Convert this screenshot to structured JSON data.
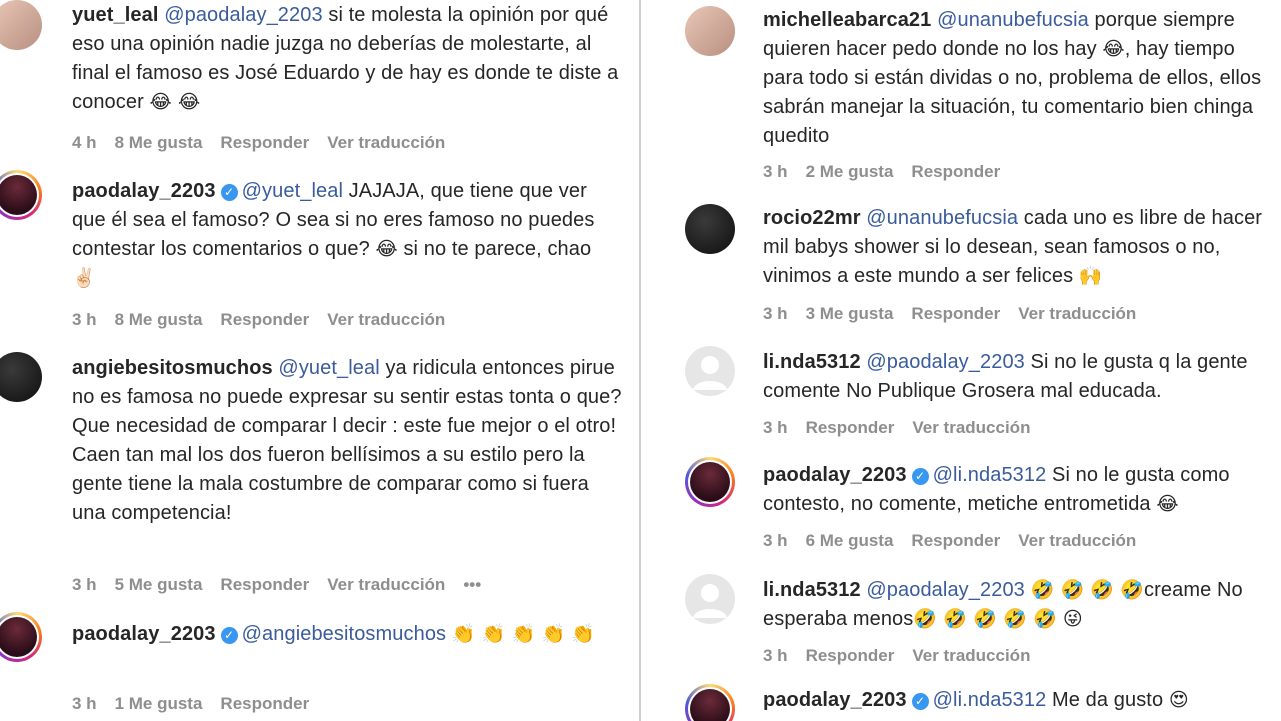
{
  "left": [
    {
      "username": "yuet_leal",
      "verified": false,
      "mention": "@paodalay_2203",
      "text": " si te molesta la opinión por qué eso una opinión nadie juzga no deberías de molestarte, al final el famoso es José Eduardo y de hay es donde te diste a conocer ",
      "emoji": "😂 😂",
      "time": "4 h",
      "likes": "8 Me gusta",
      "reply": "Responder",
      "translate": "Ver traducción"
    },
    {
      "username": "paodalay_2203",
      "verified": true,
      "mention": "@yuet_leal",
      "text": " JAJAJA, que tiene que ver que él sea el famoso? O sea si no eres famoso no puedes contestar los comentarios o que? ",
      "emoji": "😂",
      "text2": " si no te parece, chao ",
      "emoji2": "✌🏻",
      "time": "3 h",
      "likes": "8 Me gusta",
      "reply": "Responder",
      "translate": "Ver traducción"
    },
    {
      "username": "angiebesitosmuchos",
      "verified": false,
      "mention": "@yuet_leal",
      "text": " ya ridicula entonces pirue no es famosa no puede expresar su sentir estas tonta o que? Que necesidad de comparar l decir : este fue mejor o el otro! Caen tan mal los dos fueron bellísimos a su estilo pero la gente tiene la mala costumbre de comparar como si fuera una competencia!",
      "time": "3 h",
      "likes": "5 Me gusta",
      "reply": "Responder",
      "translate": "Ver traducción",
      "more": "•••"
    },
    {
      "username": "paodalay_2203",
      "verified": true,
      "mention": "@angiebesitosmuchos",
      "text": " ",
      "emoji": "👏 👏 👏 👏 👏",
      "time": "3 h",
      "likes": "1 Me gusta",
      "reply": "Responder"
    }
  ],
  "right": [
    {
      "username": "michelleabarca21",
      "verified": false,
      "mention": "@unanubefucsia",
      "text": " porque siempre quieren hacer pedo donde no los hay ",
      "emoji": "😂",
      "text2": ", hay tiempo para todo si están dividas o no, problema de ellos, ellos sabrán manejar la situación, tu comentario bien chinga quedito",
      "time": "3 h",
      "likes": "2 Me gusta",
      "reply": "Responder"
    },
    {
      "username": "rocio22mr",
      "verified": false,
      "mention": "@unanubefucsia",
      "text": " cada uno es libre de hacer mil babys shower si lo desean, sean famosos o no, vinimos a este mundo a ser felices ",
      "emoji": "🙌",
      "time": "3 h",
      "likes": "3 Me gusta",
      "reply": "Responder",
      "translate": "Ver traducción"
    },
    {
      "username": "li.nda5312",
      "verified": false,
      "mention": "@paodalay_2203",
      "text": " Si no le gusta q la gente comente No Publique Grosera mal educada.",
      "time": "3 h",
      "reply": "Responder",
      "translate": "Ver traducción"
    },
    {
      "username": "paodalay_2203",
      "verified": true,
      "mention": "@li.nda5312",
      "text": " Si no le gusta como contesto, no comente, metiche entrometida ",
      "emoji": "😂",
      "time": "3 h",
      "likes": "6 Me gusta",
      "reply": "Responder",
      "translate": "Ver traducción"
    },
    {
      "username": "li.nda5312",
      "verified": false,
      "mention": "@paodalay_2203",
      "text": " ",
      "emoji": "🤣 🤣 🤣 🤣",
      "text2": "creame No esperaba menos",
      "emoji2": "🤣 🤣 🤣 🤣 🤣 😜",
      "time": "3 h",
      "reply": "Responder",
      "translate": "Ver traducción"
    },
    {
      "username": "paodalay_2203",
      "verified": true,
      "mention": "@li.nda5312",
      "text": " Me da gusto ",
      "emoji": "😍"
    }
  ]
}
